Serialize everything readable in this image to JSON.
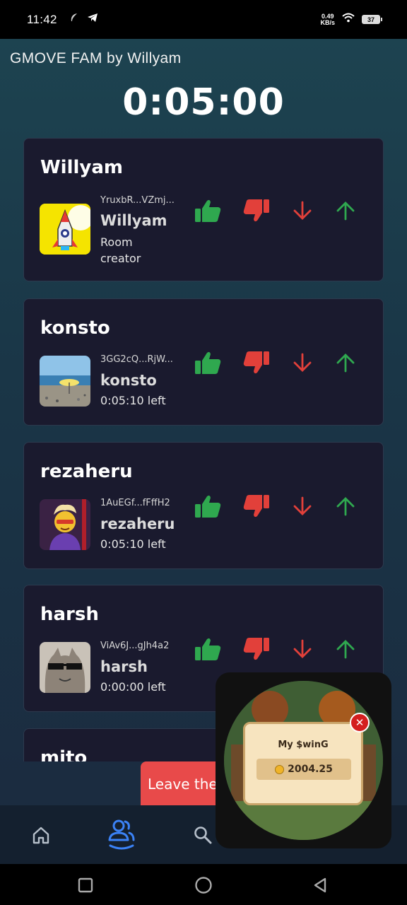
{
  "status_bar": {
    "time": "11:42",
    "net_speed_value": "0.49",
    "net_speed_unit": "KB/s",
    "battery": "37"
  },
  "room": {
    "title": "GMOVE FAM by Willyam",
    "timer": "0:05:00"
  },
  "participants": [
    {
      "card_name": "Willyam",
      "address": "YruxbR...VZmj...",
      "username": "Willyam",
      "subtitle": "Room creator",
      "avatar": "rocket-avatar"
    },
    {
      "card_name": "konsto",
      "address": "3GG2cQ...RjW...",
      "username": "konsto",
      "subtitle": "0:05:10 left",
      "avatar": "beach-avatar"
    },
    {
      "card_name": "rezaheru",
      "address": "1AuEGf...fFffH2",
      "username": "rezaheru",
      "subtitle": "0:05:10 left",
      "avatar": "cartoon-character-avatar"
    },
    {
      "card_name": "harsh",
      "address": "ViAv6J...gJh4a2",
      "username": "harsh",
      "subtitle": "0:00:00 left",
      "avatar": "cat-sunglasses-avatar"
    },
    {
      "card_name": "mito"
    }
  ],
  "leave_button": {
    "label": "Leave the"
  },
  "overlay": {
    "popup_title": "My $winG",
    "balance": "2004.25",
    "close_symbol": "✕"
  },
  "colors": {
    "thumbs_up": "#2fa84f",
    "thumbs_down": "#e2403a",
    "arrow_down": "#e2403a",
    "arrow_up": "#2fa84f",
    "nav_active": "#3b82f6",
    "leave_button": "#e84a4a"
  },
  "bottom_nav": [
    "home-icon",
    "people-icon",
    "search-icon"
  ],
  "system_nav": [
    "recents-square-icon",
    "home-circle-icon",
    "back-triangle-icon"
  ]
}
